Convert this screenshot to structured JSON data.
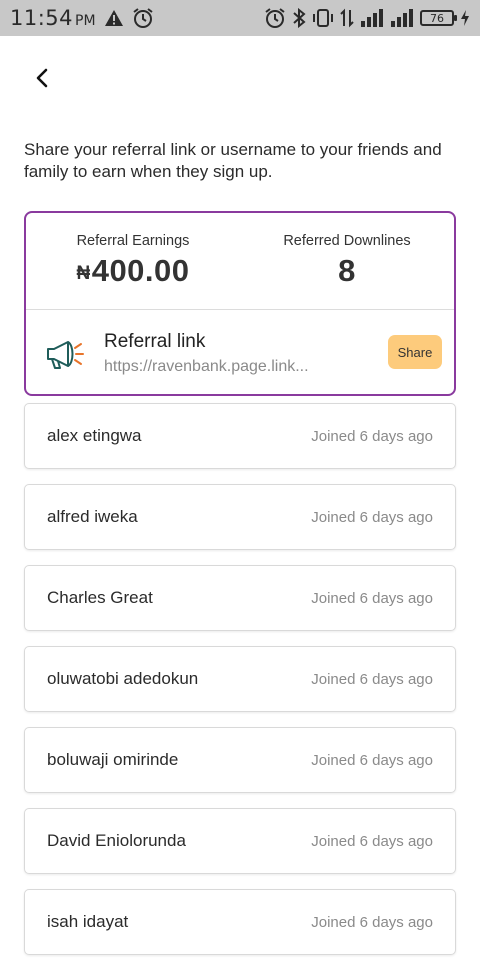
{
  "status_bar": {
    "time": "11:54",
    "ampm": "PM",
    "battery": "76",
    "icons_left": [
      "warning-icon",
      "alarm-icon"
    ],
    "icons_right": [
      "alarm-icon",
      "bluetooth-icon",
      "vibrate-icon",
      "data-arrows-icon",
      "signal-icon",
      "signal-icon",
      "battery-icon",
      "charging-icon"
    ]
  },
  "header": {
    "back_icon": "chevron-left-icon"
  },
  "intro_text": "Share your referral link or username to your friends and family to earn when they sign up.",
  "summary": {
    "earnings_label": "Referral Earnings",
    "currency_symbol": "₦",
    "earnings_value": "400.00",
    "downlines_label": "Referred Downlines",
    "downlines_value": "8"
  },
  "referral_link": {
    "icon": "megaphone-icon",
    "title": "Referral link",
    "url": "https://ravenbank.page.link...",
    "share_label": "Share"
  },
  "referrals": [
    {
      "name": "alex etingwa",
      "joined": "Joined 6 days ago"
    },
    {
      "name": "alfred iweka",
      "joined": "Joined 6 days ago"
    },
    {
      "name": "Charles Great",
      "joined": "Joined 6 days ago"
    },
    {
      "name": "oluwatobi adedokun",
      "joined": "Joined 6 days ago"
    },
    {
      "name": "boluwaji omirinde",
      "joined": "Joined 6 days ago"
    },
    {
      "name": "David Eniolorunda",
      "joined": "Joined 6 days ago"
    },
    {
      "name": "isah idayat",
      "joined": "Joined 6 days ago"
    }
  ],
  "colors": {
    "accent_border": "#8a3a9e",
    "share_button": "#fdcb7c",
    "status_bar": "#c8c8c8",
    "megaphone_teal": "#1f5d5a",
    "megaphone_orange": "#e8742a"
  }
}
